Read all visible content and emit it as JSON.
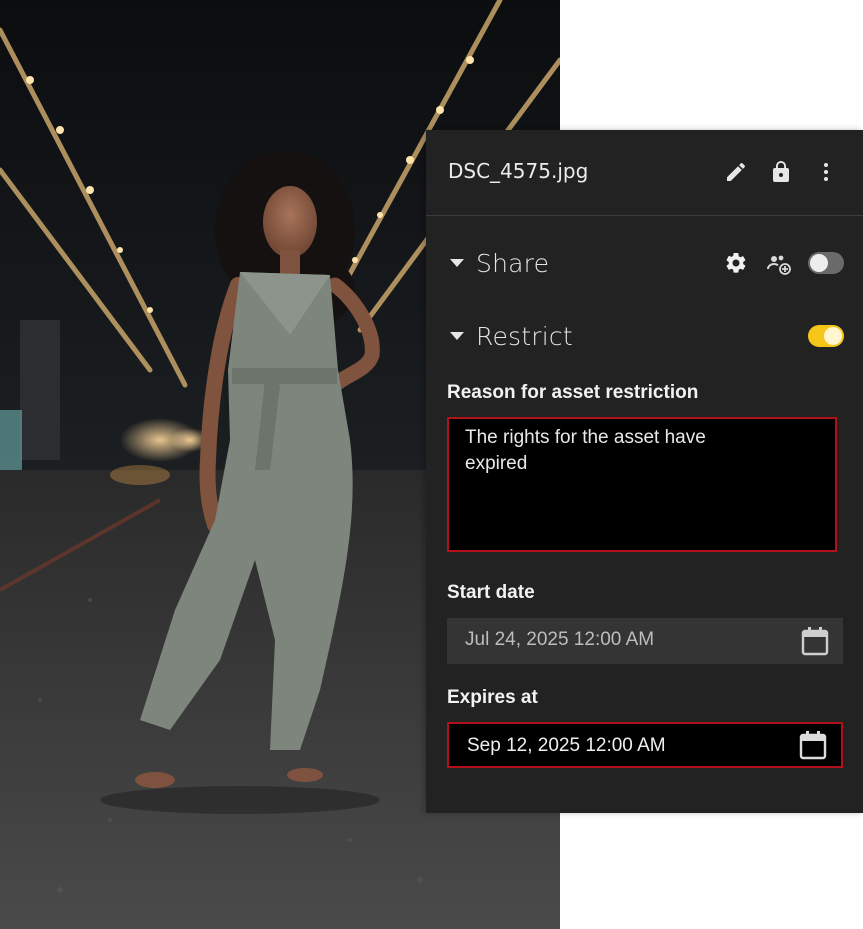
{
  "photo": {
    "alt_subject": "woman-in-jumpsuit"
  },
  "panel": {
    "file_name": "DSC_4575.jpg",
    "header_icons": [
      "pencil-icon",
      "lock-icon",
      "more-vert-icon"
    ],
    "share": {
      "title": "Share",
      "icons": [
        "gear-icon",
        "add-user-icon"
      ],
      "toggle_on": false
    },
    "restrict": {
      "title": "Restrict",
      "toggle_on": true
    },
    "reason": {
      "label": "Reason for asset restriction",
      "value": "The rights for the asset have\nexpired"
    },
    "start_date": {
      "label": "Start date",
      "value": "Jul 24, 2025 12:00 AM"
    },
    "expires_at": {
      "label": "Expires at",
      "value": "Sep 12, 2025 12:00 AM"
    }
  },
  "colors": {
    "panel_bg": "#222222",
    "accent_toggle": "#f5c518",
    "error_border": "#b0111a"
  }
}
